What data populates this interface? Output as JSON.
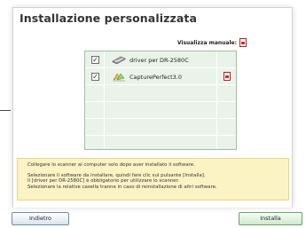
{
  "window": {
    "title": "Installazione personalizzata",
    "manual_label": "Visualizza manuale:"
  },
  "software_list": [
    {
      "checked": true,
      "label": "driver per DR-2580C",
      "icon": "scanner-icon",
      "has_manual": false
    },
    {
      "checked": true,
      "label": "CapturePerfect3.0",
      "icon": "capture-perfect-icon",
      "has_manual": true
    }
  ],
  "empty_rows": 4,
  "info": {
    "line1": "Collegare lo scanner al computer solo dopo aver installato il software.",
    "line2": "Selezionare il software da installare, quindi fare clic sul pulsante [Installa].",
    "line3": "Il [driver per DR-2580C] è obbligatorio per utilizzare lo scanner.",
    "line4": "Selezionare la relative casella tranne in caso di reinstallazione di altri software."
  },
  "buttons": {
    "back_label": "Indietro",
    "install_label": "Installa"
  },
  "colors": {
    "list_background": "#eaf3e9",
    "info_background": "#fbf3c4",
    "pdf_red": "#d22222"
  }
}
